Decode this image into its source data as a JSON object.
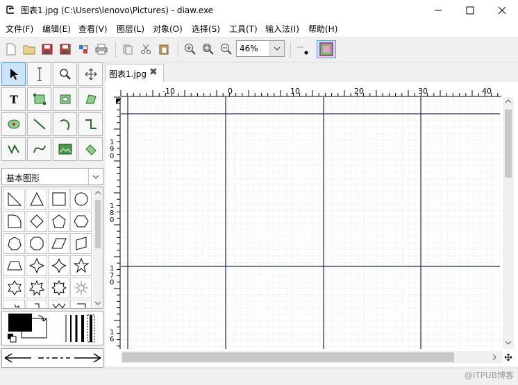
{
  "window": {
    "title": "图表1.jpg (C:\\Users\\lenovo\\Pictures) - diaw.exe",
    "minimize_icon": "minimize-icon",
    "maximize_icon": "maximize-icon",
    "close_icon": "close-icon"
  },
  "menu": [
    "文件(F)",
    "编辑(E)",
    "查看(V)",
    "图层(L)",
    "对象(O)",
    "选择(S)",
    "工具(T)",
    "输入法(I)",
    "帮助(H)"
  ],
  "toolbar": {
    "icons": [
      "new-file-icon",
      "open-folder-icon",
      "save-icon",
      "save-as-icon",
      "export-icon",
      "print-icon",
      "copy-icon",
      "cut-icon",
      "paste-icon",
      "zoom-in-icon",
      "zoom-fit-icon",
      "zoom-out-icon",
      "line-style-icon",
      "fill-color-icon"
    ],
    "zoom_value": "46%"
  },
  "tools": {
    "row_icons": [
      "pointer-icon",
      "text-cursor-icon",
      "magnifier-icon",
      "move-icon",
      "text-tool-icon",
      "box-icon",
      "ellipse-box-icon",
      "polygon-icon",
      "bezier-ellipse-icon",
      "line-icon",
      "arc-icon",
      "zigzag-icon",
      "polyline-icon",
      "bezier-icon",
      "image-icon",
      "outline-icon"
    ],
    "shape_category": "基本图形"
  },
  "document": {
    "tab_label": "图表1.jpg",
    "ruler_labels": [
      "-10",
      "0",
      "10",
      "20",
      "30",
      "40"
    ],
    "vruler_labels": [
      "1",
      "9",
      "0",
      "1",
      "8",
      "0",
      "1",
      "7",
      "0",
      "1",
      "6"
    ]
  },
  "colors": {
    "foreground": "#000000",
    "background": "#ffffff",
    "grid_major": "#1c2a5a",
    "grid_minor": "#d6e2e6",
    "selection": "#cce4f7"
  },
  "watermark": "@ITPUB博客"
}
